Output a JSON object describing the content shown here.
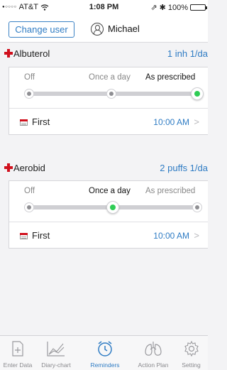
{
  "status_bar": {
    "signal": "●○○○○",
    "carrier": "AT&T",
    "wifi": "wifi-icon",
    "time": "1:08 PM",
    "indicators": "⇗ ✱",
    "battery": "100%"
  },
  "header": {
    "change_user_label": "Change user",
    "user_name": "Michael"
  },
  "medications": [
    {
      "name": "Albuterol",
      "dose": "1 inh 1/da",
      "frequency_options": [
        "Off",
        "Once a day",
        "As prescribed"
      ],
      "selected_frequency": "As prescribed",
      "reminder_label": "First",
      "reminder_time": "10:00 AM"
    },
    {
      "name": "Aerobid",
      "dose": "2 puffs 1/da",
      "frequency_options": [
        "Off",
        "Once a day",
        "As prescribed"
      ],
      "selected_frequency": "Once a day",
      "reminder_label": "First",
      "reminder_time": "10:00 AM"
    }
  ],
  "chevron": ">",
  "tab_bar": {
    "tabs": [
      {
        "label": "Enter Data",
        "icon": "enter-data-icon"
      },
      {
        "label": "Diary-chart",
        "icon": "diary-chart-icon"
      },
      {
        "label": "Reminders",
        "icon": "reminders-clock-icon"
      },
      {
        "label": "Action Plan",
        "icon": "lungs-icon"
      },
      {
        "label": "Setting",
        "icon": "gear-icon"
      }
    ],
    "active_tab": "Reminders"
  },
  "colors": {
    "accent": "#2f7cc4",
    "cross_red": "#d0101d",
    "active_knob": "#2fcc55"
  }
}
